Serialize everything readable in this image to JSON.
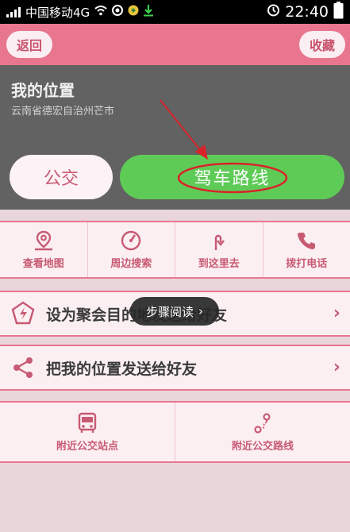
{
  "status_bar": {
    "carrier": "中国移动4G",
    "time": "22:40",
    "icons": [
      "signal-icon",
      "wifi-icon",
      "record-icon",
      "app-icon",
      "download-icon",
      "alarm-icon",
      "battery-icon"
    ]
  },
  "header": {
    "back_label": "返回",
    "favorite_label": "收藏",
    "accent_color": "#e9768f"
  },
  "location": {
    "title": "我的位置",
    "address": "云南省德宏自治州芒市"
  },
  "route_buttons": {
    "bus_label": "公交",
    "drive_label": "驾车路线"
  },
  "actions": [
    {
      "label": "查看地图",
      "icon": "map-pin-icon"
    },
    {
      "label": "周边搜索",
      "icon": "radar-icon"
    },
    {
      "label": "到这里去",
      "icon": "turn-arrow-icon"
    },
    {
      "label": "拨打电话",
      "icon": "phone-icon"
    }
  ],
  "rows": [
    {
      "label": "设为聚会目的地发送给好友",
      "icon": "meetup-icon"
    },
    {
      "label": "把我的位置发送给好友",
      "icon": "share-icon"
    }
  ],
  "toast": {
    "label": "步骤阅读"
  },
  "nearby": [
    {
      "label": "附近公交站点",
      "icon": "bus-stop-icon"
    },
    {
      "label": "附近公交路线",
      "icon": "bus-route-icon"
    }
  ]
}
